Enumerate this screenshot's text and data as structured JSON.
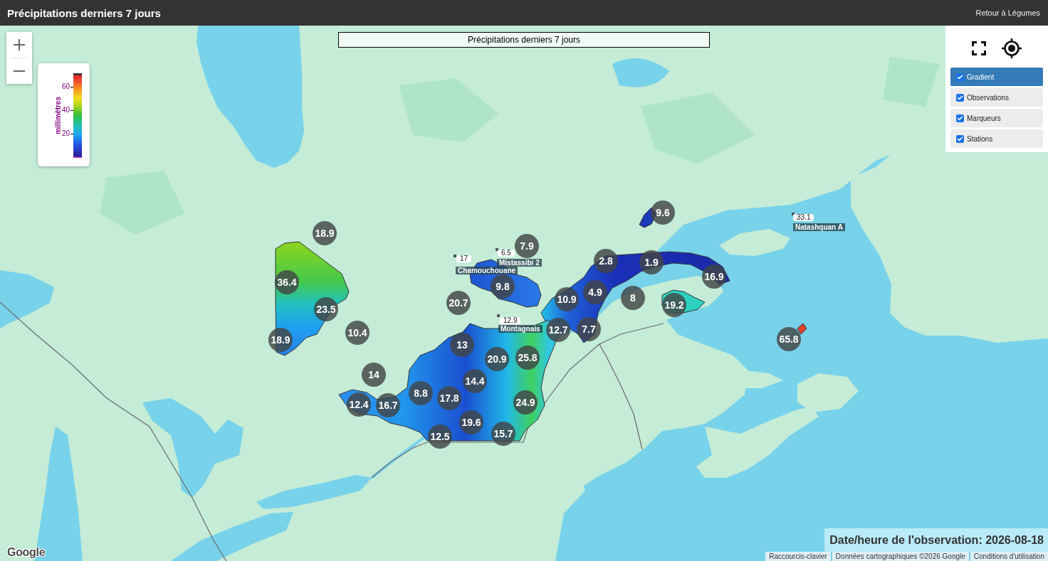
{
  "header": {
    "title": "Précipitations derniers 7 jours",
    "link": "Retour à Légumes"
  },
  "map": {
    "title_box": "Précipitations derniers 7 jours",
    "legend": {
      "title": "millimètres",
      "ticks": [
        "60",
        "40",
        "20"
      ]
    },
    "layers": [
      {
        "label": "Gradient",
        "checked": true,
        "selected": true
      },
      {
        "label": "Observations",
        "checked": true,
        "selected": false
      },
      {
        "label": "Marqueurs",
        "checked": true,
        "selected": false
      },
      {
        "label": "Stations",
        "checked": true,
        "selected": false
      }
    ],
    "markers": [
      {
        "value": "18.9"
      },
      {
        "value": "36.4"
      },
      {
        "value": "23.5"
      },
      {
        "value": "18.9"
      },
      {
        "value": "10.4"
      },
      {
        "value": "20.7"
      },
      {
        "value": "7.9"
      },
      {
        "value": "9.8"
      },
      {
        "value": "2.8"
      },
      {
        "value": "9.6"
      },
      {
        "value": "1.9"
      },
      {
        "value": "16.9"
      },
      {
        "value": "10.9"
      },
      {
        "value": "4.9"
      },
      {
        "value": "8"
      },
      {
        "value": "19.2"
      },
      {
        "value": "12.7"
      },
      {
        "value": "7.7"
      },
      {
        "value": "13"
      },
      {
        "value": "20.9"
      },
      {
        "value": "25.8"
      },
      {
        "value": "65.8"
      },
      {
        "value": "14"
      },
      {
        "value": "14.4"
      },
      {
        "value": "8.8"
      },
      {
        "value": "17.8"
      },
      {
        "value": "12.4"
      },
      {
        "value": "16.7"
      },
      {
        "value": "24.9"
      },
      {
        "value": "19.6"
      },
      {
        "value": "12.5"
      },
      {
        "value": "15.7"
      }
    ],
    "stations": [
      {
        "value": "17",
        "name": "Chamouchouane"
      },
      {
        "value": "6.5",
        "name": "Mistassibi 2"
      },
      {
        "value": "12.9",
        "name": "Montagnais"
      },
      {
        "value": "33.1",
        "name": "Natashquan A"
      }
    ],
    "observation_date": "Date/heure de l'observation: 2026-08-18",
    "logo": "Google",
    "attribution": [
      "Raccourcis-clavier",
      "Données cartographiques ©2026 Google",
      "Conditions d'utilisation"
    ]
  }
}
